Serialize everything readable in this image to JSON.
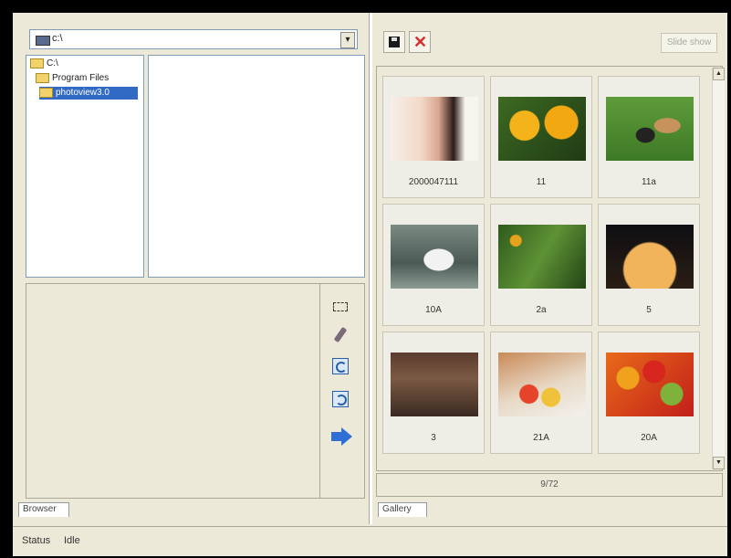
{
  "explorer": {
    "drive_label": "c:\\",
    "tree": [
      {
        "label": "C:\\"
      },
      {
        "label": "Program Files"
      },
      {
        "label": "photoview3.0",
        "selected": true
      }
    ],
    "tab_label": "Browser"
  },
  "viewer": {
    "slide_button_label": "Slide show",
    "thumbnails": [
      {
        "caption": "2000047111"
      },
      {
        "caption": "11"
      },
      {
        "caption": "11a"
      },
      {
        "caption": "10A"
      },
      {
        "caption": "2a"
      },
      {
        "caption": "5"
      },
      {
        "caption": "3"
      },
      {
        "caption": "21A"
      },
      {
        "caption": "20A"
      }
    ],
    "page_counter": "9/72",
    "tab_label": "Gallery"
  },
  "status": {
    "label": "Status",
    "value": "Idle"
  }
}
